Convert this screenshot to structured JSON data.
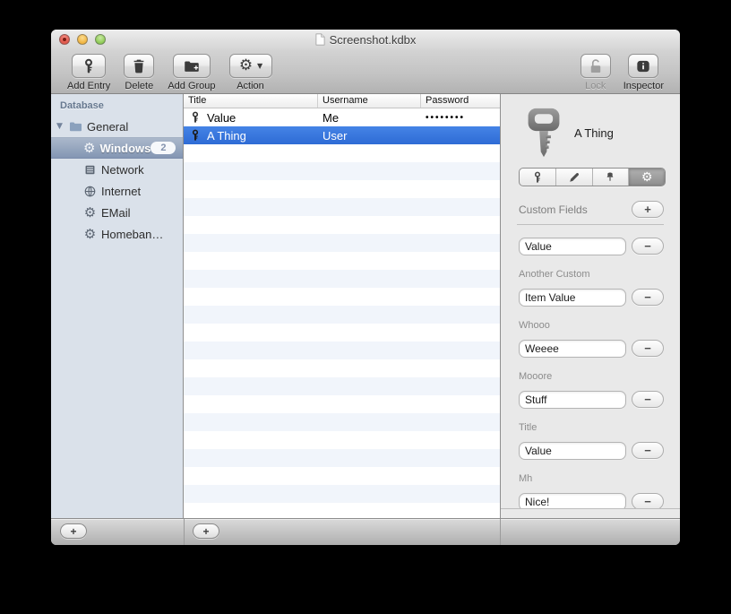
{
  "window_title": "Screenshot.kdbx",
  "toolbar": {
    "left": [
      {
        "label": "Add Entry",
        "icon": "key-icon",
        "enabled": true,
        "dropdown": false
      },
      {
        "label": "Delete",
        "icon": "trash-icon",
        "enabled": true,
        "dropdown": false
      },
      {
        "label": "Add Group",
        "icon": "folder-add-icon",
        "enabled": true,
        "dropdown": false
      },
      {
        "label": "Action",
        "icon": "gear-icon",
        "enabled": true,
        "dropdown": true
      }
    ],
    "right": [
      {
        "label": "Lock",
        "icon": "lock-open-icon",
        "enabled": false,
        "dropdown": false
      },
      {
        "label": "Inspector",
        "icon": "info-icon",
        "enabled": true,
        "dropdown": false
      }
    ]
  },
  "sidebar": {
    "header": "Database",
    "items": [
      {
        "label": "General",
        "icon": "folder-icon",
        "depth": 0,
        "expanded": true,
        "selected": false,
        "badge": ""
      },
      {
        "label": "Windows",
        "icon": "gear-icon",
        "depth": 1,
        "selected": true,
        "badge": "2"
      },
      {
        "label": "Network",
        "icon": "server-icon",
        "depth": 1,
        "selected": false,
        "badge": ""
      },
      {
        "label": "Internet",
        "icon": "globe-icon",
        "depth": 1,
        "selected": false,
        "badge": ""
      },
      {
        "label": "EMail",
        "icon": "gear-icon",
        "depth": 1,
        "selected": false,
        "badge": ""
      },
      {
        "label": "Homeban…",
        "icon": "gear-icon",
        "depth": 1,
        "selected": false,
        "badge": ""
      }
    ],
    "add_button_label": "+"
  },
  "entries": {
    "columns": [
      "Title",
      "Username",
      "Password"
    ],
    "rows": [
      {
        "icon": "key-icon",
        "title": "Value",
        "username": "Me",
        "password": "••••••••",
        "selected": false
      },
      {
        "icon": "key-icon",
        "title": "A Thing",
        "username": "User",
        "password": "",
        "selected": true
      }
    ],
    "add_button_label": "+"
  },
  "inspector": {
    "entry_icon": "key-icon",
    "entry_title": "A Thing",
    "tabs": [
      {
        "icon": "key-icon",
        "selected": false
      },
      {
        "icon": "pencil-icon",
        "selected": false
      },
      {
        "icon": "pin-icon",
        "selected": false
      },
      {
        "icon": "gear-icon",
        "selected": true
      }
    ],
    "custom_fields_title": "Custom Fields",
    "add_button_label": "+",
    "remove_button_label": "−",
    "fields": [
      {
        "label": "",
        "value": "Value"
      },
      {
        "label": "Another Custom",
        "value": "Item Value"
      },
      {
        "label": "Whooo",
        "value": "Weeee"
      },
      {
        "label": "Mooore",
        "value": "Stuff"
      },
      {
        "label": "Title",
        "value": "Value"
      },
      {
        "label": "Mh",
        "value": "Nice!"
      }
    ]
  },
  "colors": {
    "selection_blue": "#3a78dd",
    "sidebar_selection": "#93a4bd",
    "row_stripe": "#f1f5fb",
    "window_chrome": "#c6c6c6"
  }
}
